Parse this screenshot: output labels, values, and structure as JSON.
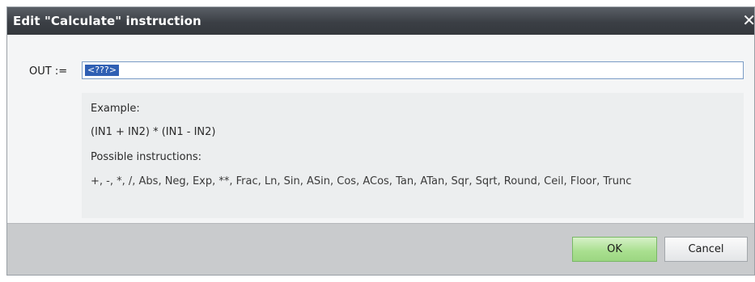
{
  "dialog": {
    "title": "Edit \"Calculate\" instruction",
    "close_icon": "close-icon"
  },
  "form": {
    "out_label": "OUT :=",
    "expression_value": "<???>"
  },
  "help": {
    "example_heading": "Example:",
    "example_formula": "(IN1 + IN2) * (IN1 - IN2)",
    "instructions_heading": "Possible instructions:",
    "instructions_list": "+, -, *, /, Abs, Neg, Exp, **, Frac, Ln, Sin, ASin, Cos, ACos, Tan, ATan, Sqr, Sqrt, Round, Ceil, Floor, Trunc"
  },
  "footer": {
    "ok_label": "OK",
    "cancel_label": "Cancel"
  },
  "colors": {
    "title_bar": "#3b3f45",
    "ok_button": "#a8df8e",
    "selection": "#2f5fb3"
  }
}
